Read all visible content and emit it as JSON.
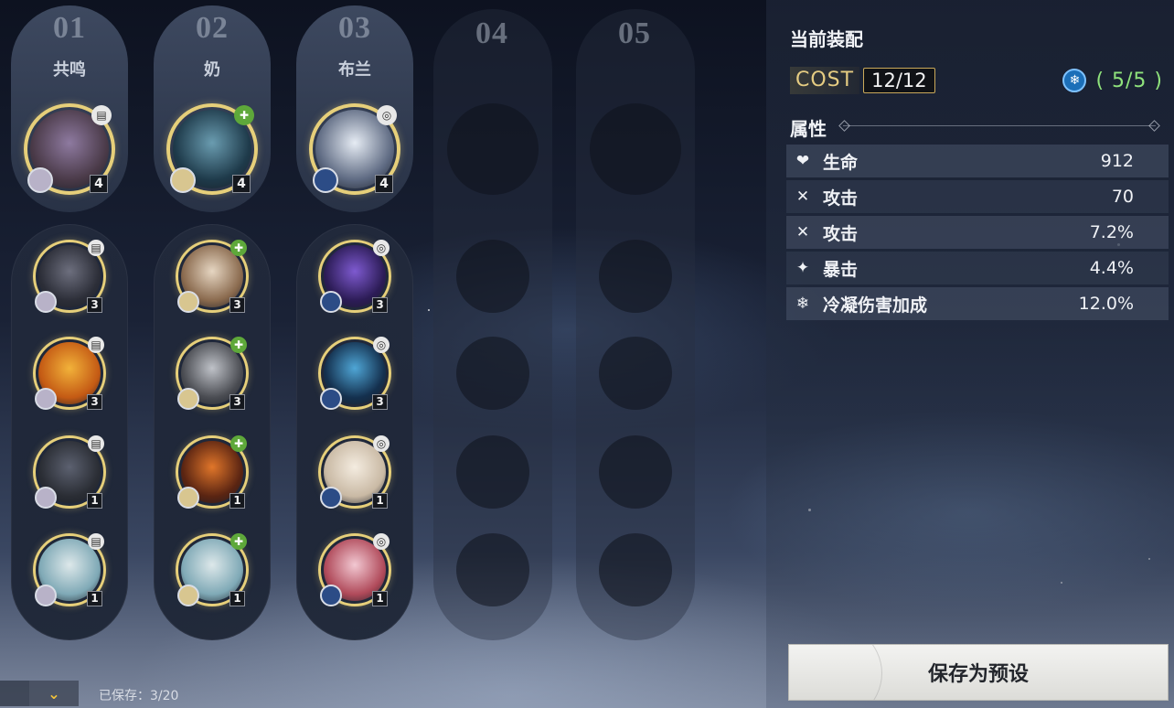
{
  "columns": [
    {
      "number": "01",
      "name": "共鸣",
      "echoes": [
        {
          "cost": "4",
          "sonata": "resonance-icon",
          "colors": [
            "#4a3a48",
            "#8e7aa0"
          ],
          "badge_color": "#e8e8e8"
        },
        {
          "cost": "3",
          "sonata": "resonance-icon",
          "colors": [
            "#2c2e38",
            "#6d6f7e"
          ],
          "badge_color": "#e8e8e8"
        },
        {
          "cost": "3",
          "sonata": "resonance-icon",
          "colors": [
            "#c45a14",
            "#f2b23a"
          ],
          "badge_color": "#e8e8e8"
        },
        {
          "cost": "1",
          "sonata": "resonance-icon",
          "colors": [
            "#2a2d34",
            "#5c6170"
          ],
          "badge_color": "#e8e8e8"
        },
        {
          "cost": "1",
          "sonata": "resonance-icon",
          "colors": [
            "#7fa9b6",
            "#dde8ea"
          ],
          "badge_color": "#e8e8e8"
        }
      ]
    },
    {
      "number": "02",
      "name": "奶",
      "echoes": [
        {
          "cost": "4",
          "sonata": "healing-icon",
          "colors": [
            "#1e3a4a",
            "#6a9cb0"
          ],
          "badge_color": "#5ea83a"
        },
        {
          "cost": "3",
          "sonata": "healing-icon",
          "colors": [
            "#8a6a4e",
            "#e6d6c2"
          ],
          "badge_color": "#5ea83a"
        },
        {
          "cost": "3",
          "sonata": "healing-icon",
          "colors": [
            "#4a4c52",
            "#bfc2c8"
          ],
          "badge_color": "#5ea83a"
        },
        {
          "cost": "1",
          "sonata": "healing-icon",
          "colors": [
            "#5a2412",
            "#e0762a"
          ],
          "badge_color": "#5ea83a"
        },
        {
          "cost": "1",
          "sonata": "healing-icon",
          "colors": [
            "#7fa9b6",
            "#dde8ea"
          ],
          "badge_color": "#5ea83a"
        }
      ]
    },
    {
      "number": "03",
      "name": "布兰",
      "echoes": [
        {
          "cost": "4",
          "sonata": "target-icon",
          "colors": [
            "#5e6a82",
            "#e6ecf4"
          ],
          "badge_color": "#e8e8e8"
        },
        {
          "cost": "3",
          "sonata": "target-icon",
          "colors": [
            "#2c1c56",
            "#7e5ad0"
          ],
          "badge_color": "#e8e8e8"
        },
        {
          "cost": "3",
          "sonata": "target-icon",
          "colors": [
            "#14304e",
            "#4fa6d6"
          ],
          "badge_color": "#e8e8e8"
        },
        {
          "cost": "1",
          "sonata": "target-icon",
          "colors": [
            "#c9b9a4",
            "#f4ece0"
          ],
          "badge_color": "#e8e8e8"
        },
        {
          "cost": "1",
          "sonata": "target-icon",
          "colors": [
            "#b04a5a",
            "#f2c8d2"
          ],
          "badge_color": "#e8e8e8"
        }
      ]
    },
    {
      "number": "04",
      "name": "",
      "echoes": []
    },
    {
      "number": "05",
      "name": "",
      "echoes": []
    }
  ],
  "panel": {
    "title": "当前装配",
    "cost_label": "COST",
    "cost_value": "12/12",
    "set_icon": "frost-icon",
    "set_count": "( 5/5 )",
    "attributes_title": "属性",
    "stats": [
      {
        "icon": "heart-icon",
        "name": "生命",
        "value": "912"
      },
      {
        "icon": "swords-icon",
        "name": "攻击",
        "value": "70"
      },
      {
        "icon": "swords-icon",
        "name": "攻击",
        "value": "7.2%"
      },
      {
        "icon": "crit-icon",
        "name": "暴击",
        "value": "4.4%"
      },
      {
        "icon": "glacio-icon",
        "name": "冷凝伤害加成",
        "value": "12.0%"
      }
    ],
    "save_button": "保存为预设"
  },
  "footer": {
    "saved_text": "已保存：3/20"
  },
  "colors": {
    "gold_ring": "#e6cf7a",
    "set_count": "#8fe37c",
    "cost_label": "#e5cc82",
    "expand_arrow": "#f2c23a"
  }
}
